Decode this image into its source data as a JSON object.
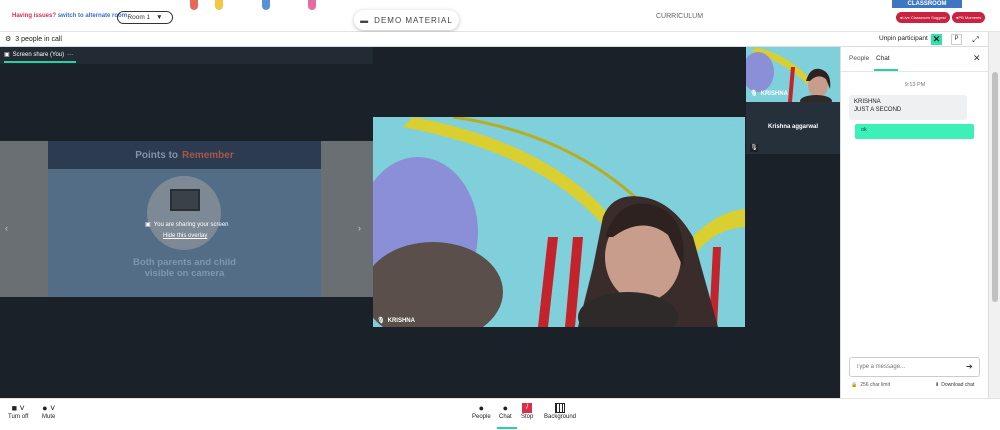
{
  "header": {
    "issues_text": "Having issues?",
    "switch_link": "switch to alternate room",
    "room_label": "Room 1",
    "demo_material": "DEMO MATERIAL",
    "curriculum": "CURRICULUM",
    "classroom_tab": "CLASSROOM",
    "live_suggest": "Live Classroom Suggest",
    "pb_moments": "PB Moments"
  },
  "call": {
    "people_count": "3 people in call",
    "unpin": "Unpin participant",
    "p_button": "P"
  },
  "share": {
    "tab_label": "Screen share (You)",
    "tab_more": "···",
    "slide_title_a": "Points to",
    "slide_title_b": "Remember",
    "slide_text_1": "Both parents and child",
    "slide_text_2": "visible on camera",
    "overlay_msg": "You are sharing your screen",
    "hide_overlay": "Hide this overlay"
  },
  "main_video": {
    "name": "KRISHNA"
  },
  "thumbnails": {
    "thumb1_name": "KRISHNA",
    "thumb2_name": "Krishna aggarwal"
  },
  "chat": {
    "tab_people": "People",
    "tab_chat": "Chat",
    "time": "9:13 PM",
    "incoming_sender": "KRISHNA",
    "incoming_text": "JUST A SECOND",
    "outgoing_text": "ok",
    "input_placeholder": "Type a message...",
    "char_limit": "256 char limit",
    "download": "Download chat"
  },
  "toolbar": {
    "turn_off": "Turn off",
    "mute": "Mute",
    "people": "People",
    "chat": "Chat",
    "stop": "Stop",
    "background": "Background"
  },
  "colors": {
    "accent": "#2ad1a0",
    "alert": "#d6304a",
    "link": "#3b6fc9"
  }
}
